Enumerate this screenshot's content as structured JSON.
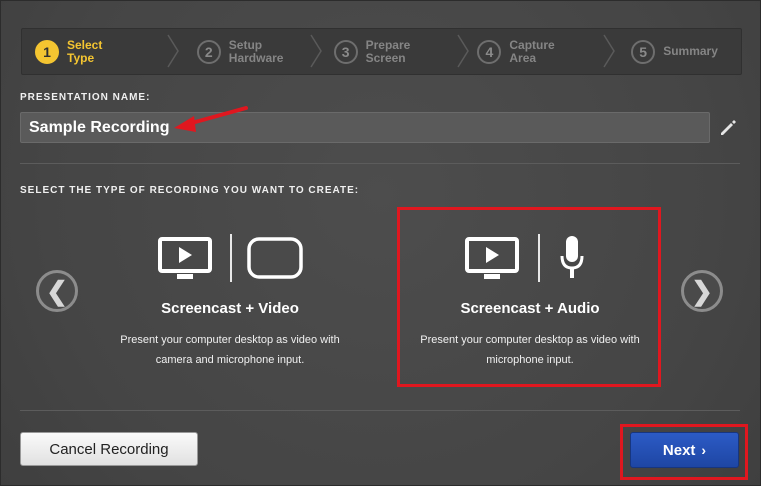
{
  "steps": [
    {
      "num": "1",
      "line1": "Select",
      "line2": "Type",
      "active": true
    },
    {
      "num": "2",
      "line1": "Setup",
      "line2": "Hardware",
      "active": false
    },
    {
      "num": "3",
      "line1": "Prepare",
      "line2": "Screen",
      "active": false
    },
    {
      "num": "4",
      "line1": "Capture",
      "line2": "Area",
      "active": false
    },
    {
      "num": "5",
      "line1": "Summary",
      "line2": "",
      "active": false
    }
  ],
  "presentation": {
    "label": "PRESENTATION NAME:",
    "value": "Sample Recording"
  },
  "recording_type": {
    "label": "SELECT THE TYPE OF RECORDING YOU WANT TO CREATE:",
    "cards": [
      {
        "title": "Screencast + Video",
        "desc_line1": "Present your computer desktop as video with",
        "desc_line2": "camera and microphone input.",
        "selected": false
      },
      {
        "title": "Screencast + Audio",
        "desc_line1": "Present your computer desktop as video with",
        "desc_line2": "microphone input.",
        "selected": true
      }
    ],
    "prev_glyph": "❮",
    "next_glyph": "❯"
  },
  "footer": {
    "cancel_label": "Cancel Recording",
    "next_label": "Next",
    "next_chevron": "›"
  },
  "colors": {
    "accent_active": "#f4c531",
    "primary_button": "#2550b8",
    "annotation_red": "#e0171f"
  }
}
